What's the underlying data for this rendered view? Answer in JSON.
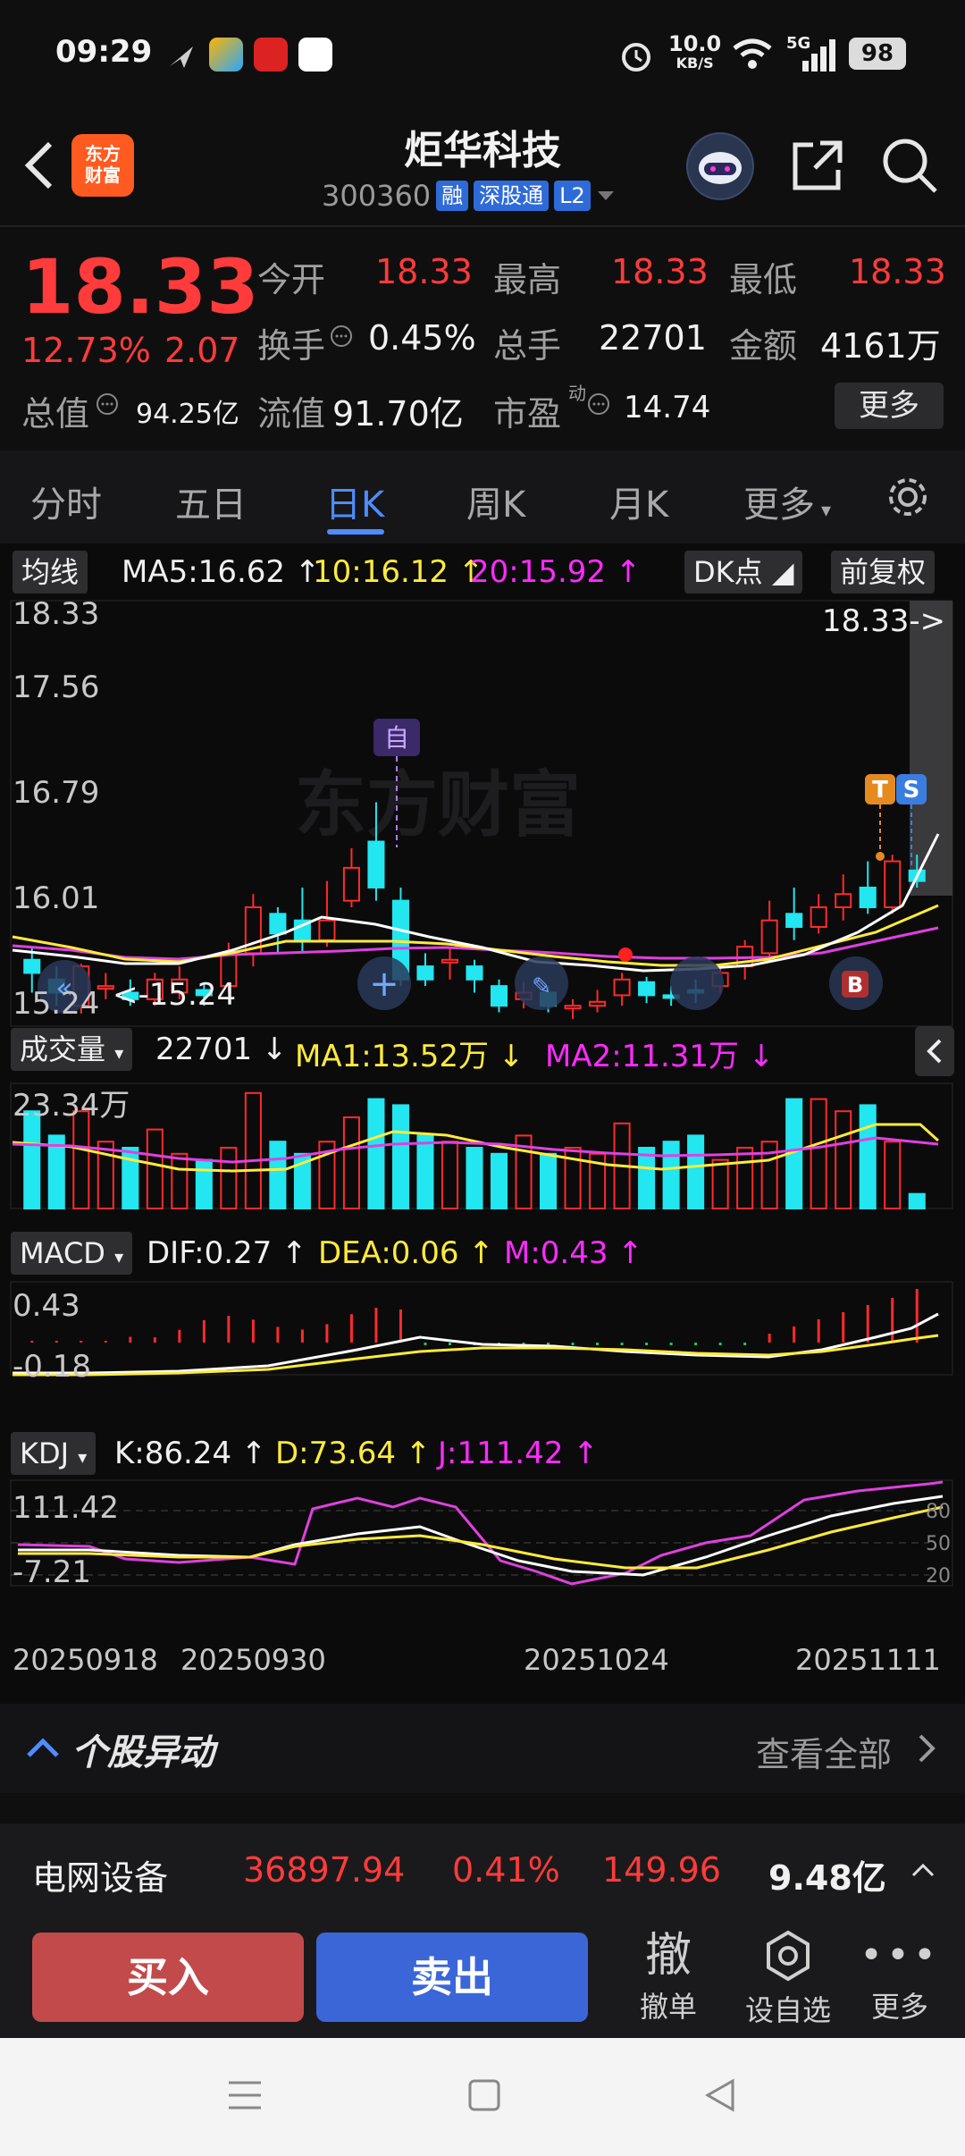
{
  "status_bar": {
    "time": "09:29",
    "net_speed_top": "10.0",
    "net_speed_unit": "KB/S",
    "signal": "5G",
    "battery": "98"
  },
  "header": {
    "logo_text_1": "东方",
    "logo_text_2": "财富",
    "title": "炬华科技",
    "code": "300360",
    "tags": [
      "融",
      "深股通",
      "L2"
    ]
  },
  "quote": {
    "price": "18.33",
    "change_pct": "12.73%",
    "change": "2.07",
    "open_label": "今开",
    "open": "18.33",
    "high_label": "最高",
    "high": "18.33",
    "low_label": "最低",
    "low": "18.33",
    "turnover_label": "换手",
    "turnover": "0.45%",
    "volume_label": "总手",
    "volume": "22701",
    "amount_label": "金额",
    "amount": "4161万",
    "mktcap_label": "总值",
    "mktcap": "94.25亿",
    "float_label": "流值",
    "float_cap": "91.70亿",
    "pe_label": "市盈",
    "pe_sup": "动",
    "pe": "14.74",
    "more": "更多"
  },
  "tabs": [
    "分时",
    "五日",
    "日K",
    "周K",
    "月K",
    "更多"
  ],
  "chart": {
    "ma_label": "均线",
    "ma5": "MA5:16.62",
    "ma10": "10:16.12",
    "ma20": "20:15.92",
    "dk": "DK点",
    "adjust": "前复权",
    "y_labels": [
      "18.33",
      "17.56",
      "16.79",
      "16.01",
      "15.24"
    ],
    "last_price_label": "18.33->",
    "low_mark": "<-15.24",
    "watermark": "东方财富",
    "marker_self": "自",
    "marker_t": "T",
    "marker_s": "S",
    "marker_b": "B",
    "vol_label": "成交量",
    "vol_value": "22701",
    "vol_ma1": "MA1:13.52万",
    "vol_ma2": "MA2:11.31万",
    "vol_max": "23.34万",
    "macd_label": "MACD",
    "dif": "DIF:0.27",
    "dea": "DEA:0.06",
    "m": "M:0.43",
    "macd_top": "0.43",
    "macd_bottom": "-0.18",
    "kdj_label": "KDJ",
    "k": "K:86.24",
    "d": "D:73.64",
    "j": "J:111.42",
    "kdj_top": "111.42",
    "kdj_bottom": "-7.21",
    "kdj_levels": [
      "80",
      "50",
      "20"
    ],
    "dates": [
      "20250918",
      "20250930",
      "20251024",
      "20251111"
    ]
  },
  "chart_data": {
    "type": "candlestick",
    "y_range": [
      15.24,
      18.33
    ],
    "last": 18.33,
    "ma5": 16.62,
    "ma10": 16.12,
    "ma20": 15.92,
    "volume_last": 22701,
    "vol_ma1": "13.52万",
    "vol_ma2": "11.31万",
    "macd": {
      "dif": 0.27,
      "dea": 0.06,
      "m": 0.43
    },
    "kdj": {
      "k": 86.24,
      "d": 73.64,
      "j": 111.42
    }
  },
  "alert": {
    "title": "个股异动",
    "link": "查看全部"
  },
  "ticker": {
    "name": "电网设备",
    "value": "36897.94",
    "pct": "0.41%",
    "change": "149.96",
    "amount": "9.48亿"
  },
  "bottom_bar": {
    "buy": "买入",
    "sell": "卖出",
    "cancel_glyph": "撤",
    "cancel": "撤单",
    "watch": "设自选",
    "more": "更多"
  }
}
